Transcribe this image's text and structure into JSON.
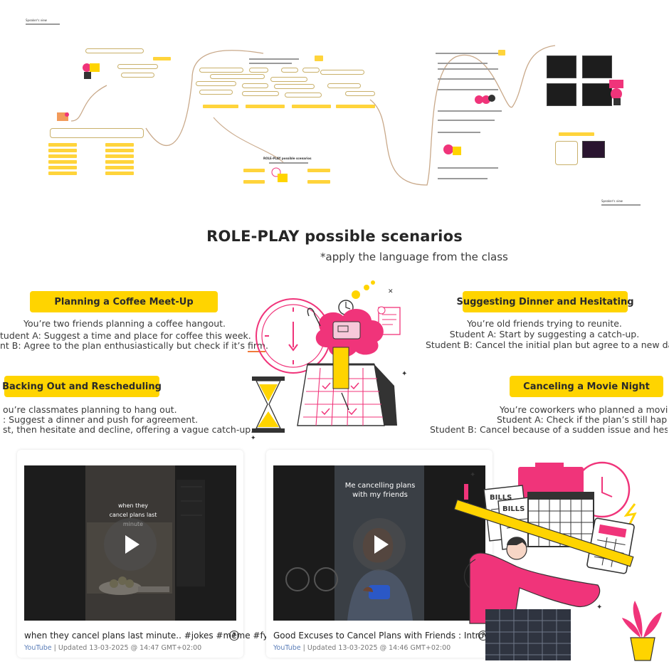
{
  "board": {
    "header_label": "Speaker's view",
    "header_label_right": "Speaker's view",
    "section_title_small": "ROLE-PLAY possible scenarios"
  },
  "slide": {
    "title": "ROLE-PLAY possible scenarios",
    "subtitle": "*apply the language from the class",
    "scenarios": [
      {
        "label": "Planning a Coffee Meet-Up",
        "lines": [
          "You’re two friends planning a coffee hangout.",
          "tudent A: Suggest a time and place for coffee this week.",
          "nt B: Agree to the plan enthusiastically but check if it’s "
        ],
        "emphasis": "firm",
        "tail": "."
      },
      {
        "label": "Suggesting Dinner and Hesitating",
        "lines": [
          "You’re old friends trying to reunite.",
          "Student A: Start by suggesting a catch-up.",
          "Student B: Cancel the initial plan but agree to a new date."
        ]
      },
      {
        "label": "Backing Out and Rescheduling",
        "lines": [
          "ou’re classmates planning to hang out.",
          ": Suggest a dinner and push for agreement.",
          "st, then hesitate and decline, offering a vague catch-up."
        ]
      },
      {
        "label": "Canceling a Movie Night",
        "lines": [
          "You’re coworkers who planned a movie n",
          "Student A: Check if the plan’s still happe",
          "Student B: Cancel because of a sudden issue and hesita"
        ]
      }
    ]
  },
  "videos": [
    {
      "caption": "when they cancel plans last minute.. #jokes #meme #fyp",
      "source": "YouTube",
      "updated": "Updated 13-03-2025 @ 14:47 GMT+02:00",
      "overlay": "when they cancel plans last minute"
    },
    {
      "caption": "Good Excuses to Cancel Plans with Friends : Introvert Pro...",
      "source": "YouTube",
      "updated": "Updated 13-03-2025 @ 14:46 GMT+02:00",
      "overlay": "Me cancelling plans with my friends"
    }
  ],
  "illustration_text": {
    "bills_1": "BILLS",
    "bills_2": "BILLS"
  },
  "colors": {
    "accent_yellow": "#ffd400",
    "accent_pink": "#f0347a",
    "ink": "#2a2a2a",
    "underline": "#f07a3a"
  },
  "icons": [
    "play-icon",
    "help-icon",
    "clock-icon",
    "calendar-icon",
    "hourglass-icon",
    "bills-icon",
    "calculator-icon"
  ]
}
